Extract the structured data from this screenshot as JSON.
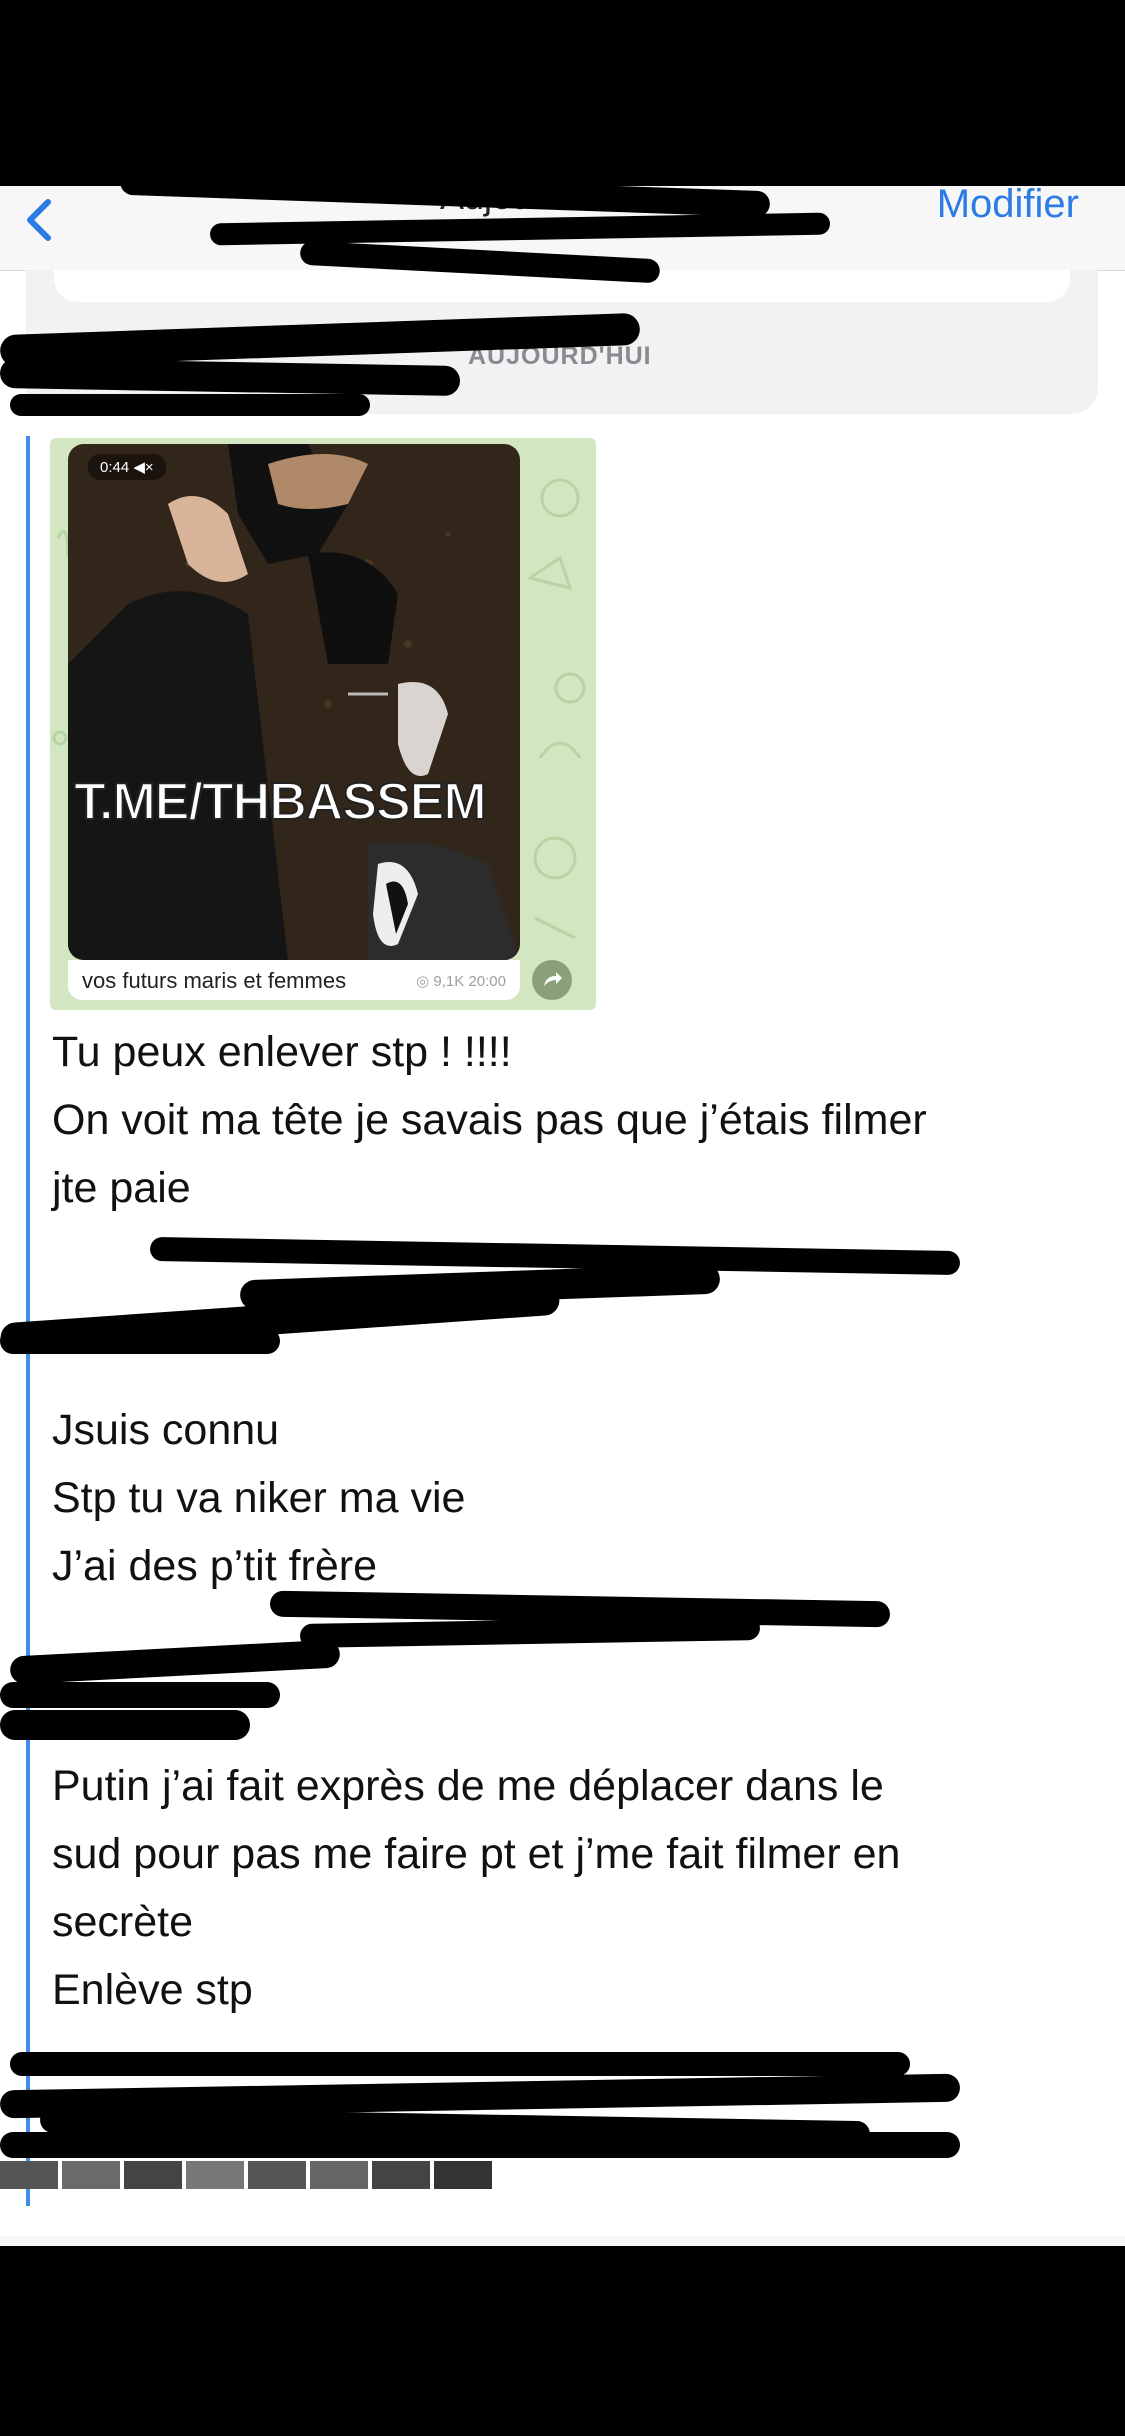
{
  "nav": {
    "title": "Aujourd'hui",
    "edit_label": "Modifier"
  },
  "date_separator": "AUJOURD'HUI",
  "media": {
    "duration": "0:44",
    "watermark": "T.ME/THBASSEM",
    "caption": "vos futurs maris et femmes",
    "views": "9,1K",
    "time": "20:00"
  },
  "messages": [
    {
      "lines": [
        "Tu peux enlever stp ! !!!!",
        "On voit ma tête je savais pas que j’étais filmer",
        "jte paie"
      ]
    },
    {
      "lines": [
        "Jsuis connu",
        "Stp tu va niker ma vie",
        "J’ai des p’tit frère"
      ]
    },
    {
      "lines": [
        "Putin j’ai fait exprès de me déplacer dans le",
        "sud pour pas me faire pt et j’me fait filmer en",
        "secrète",
        "Enlève stp"
      ]
    }
  ],
  "colors": {
    "accent": "#2d7be5",
    "quote_bar": "#3c8ee6",
    "redaction": "#000000"
  }
}
